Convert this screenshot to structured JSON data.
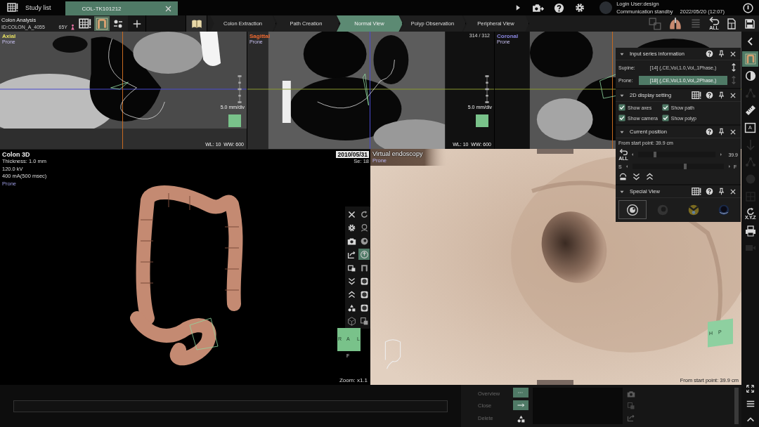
{
  "header": {
    "study_list": "Study list",
    "tabs": [
      {
        "label": "COL-TK101212",
        "selected": true
      }
    ],
    "user": "Login User:design",
    "status": "Communication standby",
    "datetime": "2022/05/20 (12:07)",
    "undo_label": "ALL"
  },
  "patient": {
    "title": "Colon Analysis",
    "id": "ID:COLON_A_4055",
    "age": "65Y"
  },
  "steps": [
    {
      "label": "Colon Extraction",
      "selected": false
    },
    {
      "label": "Path Creation",
      "selected": false
    },
    {
      "label": "Normal View",
      "selected": true
    },
    {
      "label": "Polyp Observation",
      "selected": false
    },
    {
      "label": "Peripheral View",
      "selected": false
    }
  ],
  "views": [
    {
      "title": "Axial",
      "color": "#e6e060",
      "position": "Prone",
      "scale": "5.0 mm/div",
      "window_level": "WL: 10  WW: 600"
    },
    {
      "title": "Sagittal",
      "color": "#f06a30",
      "position": "Prone",
      "counter": "314 / 312",
      "scale": "5.0 mm/div",
      "window_level": "WL: 10  WW: 600"
    },
    {
      "title": "Coronal",
      "color": "#8a86e0",
      "position": "Prone"
    }
  ],
  "colon_3d": {
    "title": "Colon 3D",
    "info": [
      "Thickness: 1.0 mm",
      "120.0 kV",
      "400 mA(500 msec)"
    ],
    "position": "Prone",
    "date": "2010/05/31",
    "series": "Se: 18",
    "zoom": "Zoom: x1.1",
    "cube": [
      "R",
      "A",
      "L",
      "F"
    ],
    "tools": [
      {
        "selected": false
      },
      {
        "selected": false
      },
      {
        "selected": false
      },
      {
        "selected": false
      },
      {
        "selected": false
      },
      {
        "selected": false
      },
      {
        "selected": false
      },
      {
        "selected": true
      },
      {
        "selected": false
      },
      {
        "selected": false
      },
      {
        "selected": false
      },
      {
        "selected": false
      },
      {
        "selected": false
      },
      {
        "selected": false
      },
      {
        "selected": false
      },
      {
        "selected": false
      },
      {
        "selected": false
      },
      {
        "selected": false
      }
    ]
  },
  "endoscopy": {
    "title": "Virtual endoscopy",
    "position": "Prone",
    "distance": "From start point: 39.9 cm",
    "cube": [
      "H",
      "P"
    ]
  },
  "panel": [
    {
      "kind": "series",
      "title": "Input series information",
      "rows": [
        {
          "label": "Supine:",
          "value": "[14] (,CE,Vol,1.0,Vol,,1Phase,)",
          "selected": false
        },
        {
          "label": "Prone:",
          "value": "[18] (,CE,Vol,1.0,Vol,,2Phase,)",
          "selected": true
        }
      ]
    },
    {
      "kind": "checks",
      "title": "2D display setting",
      "options": [
        {
          "label": "Show axes",
          "checked": true
        },
        {
          "label": "Show path",
          "checked": true
        },
        {
          "label": "Show camera",
          "checked": true
        },
        {
          "label": "Show polyp",
          "checked": true
        }
      ]
    },
    {
      "kind": "position",
      "title": "Current position",
      "distance": "From start point: 39.9 cm",
      "reset_label": "ALL",
      "sliders": [
        {
          "level": 0.22,
          "reading": "39.9"
        },
        {
          "start": "S",
          "end": "F",
          "level": 0.58
        }
      ]
    },
    {
      "kind": "special",
      "title": "Special View",
      "views": [
        {
          "selected": true
        },
        {
          "selected": false
        },
        {
          "selected": false
        },
        {
          "selected": false
        }
      ]
    }
  ],
  "sidebar": [
    {
      "selected": false,
      "disabled": false
    },
    {
      "selected": true,
      "disabled": false
    },
    {
      "selected": false,
      "disabled": false
    },
    {
      "selected": false,
      "disabled": true
    },
    {
      "selected": false,
      "disabled": false
    },
    {
      "selected": false,
      "disabled": false,
      "label": "A"
    },
    {
      "selected": false,
      "disabled": true
    },
    {
      "selected": false,
      "disabled": true
    },
    {
      "selected": false,
      "disabled": true
    },
    {
      "selected": false,
      "disabled": true
    },
    {
      "selected": false,
      "disabled": false,
      "label": "X.Y.Z"
    },
    {
      "selected": false,
      "disabled": false
    },
    {
      "selected": false,
      "disabled": true
    }
  ],
  "bottom": {
    "actions": [
      {
        "label": "Overview",
        "disabled": true
      },
      {
        "label": "Close",
        "disabled": true
      },
      {
        "label": "Delete",
        "disabled": true
      }
    ]
  }
}
